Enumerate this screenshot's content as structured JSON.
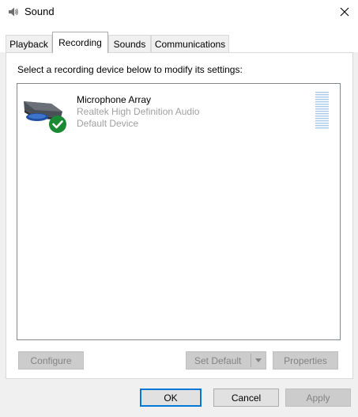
{
  "window": {
    "title": "Sound",
    "icon": "speaker-icon",
    "close_glyph": "✕"
  },
  "tabs": [
    {
      "label": "Playback",
      "active": false
    },
    {
      "label": "Recording",
      "active": true
    },
    {
      "label": "Sounds",
      "active": false
    },
    {
      "label": "Communications",
      "active": false
    }
  ],
  "panel": {
    "instruction": "Select a recording device below to modify its settings:"
  },
  "devices": [
    {
      "name": "Microphone Array",
      "driver": "Realtek High Definition Audio",
      "status": "Default Device",
      "icon": "microphone-array-icon",
      "badge": "default-checkmark-icon"
    }
  ],
  "panel_buttons": {
    "configure": "Configure",
    "set_default": "Set Default",
    "properties": "Properties"
  },
  "dialog_buttons": {
    "ok": "OK",
    "cancel": "Cancel",
    "apply": "Apply"
  },
  "colors": {
    "accent": "#0078d7",
    "check_badge": "#1b8a34",
    "disabled_text": "#838383",
    "secondary_text": "#a0a0a0",
    "level_meter": "#a9c8ea"
  }
}
